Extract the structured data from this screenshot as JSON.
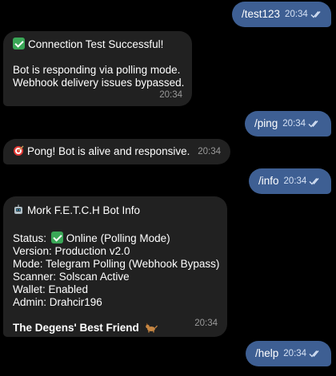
{
  "messages": [
    {
      "id": "m1",
      "direction": "outgoing",
      "text": "/test123",
      "time": "20:34"
    },
    {
      "id": "m2",
      "direction": "incoming",
      "title": "Connection Test Successful!",
      "lines": [
        "Bot is responding via polling mode.",
        "Webhook delivery issues bypassed."
      ],
      "time": "20:34"
    },
    {
      "id": "m3",
      "direction": "outgoing",
      "text": "/ping",
      "time": "20:34"
    },
    {
      "id": "m4",
      "direction": "incoming",
      "text": "Pong! Bot is alive and responsive.",
      "time": "20:34"
    },
    {
      "id": "m5",
      "direction": "outgoing",
      "text": "/info",
      "time": "20:34"
    },
    {
      "id": "m6",
      "direction": "incoming",
      "title": "Mork F.E.T.C.H Bot Info",
      "status_label": "Status:",
      "status_value": "Online (Polling Mode)",
      "lines": [
        "Version: Production v2.0",
        "Mode: Telegram Polling (Webhook Bypass)",
        "Scanner: Solscan Active",
        "Wallet: Enabled",
        "Admin: Drahcir196"
      ],
      "footer": "The Degens' Best Friend",
      "time": "20:34"
    },
    {
      "id": "m7",
      "direction": "outgoing",
      "text": "/help",
      "time": "20:34"
    }
  ],
  "icons": {
    "read_receipt": "double-check-icon",
    "success": "check-mark-emoji-icon",
    "target": "target-emoji-icon",
    "robot": "robot-emoji-icon",
    "dog": "dog-emoji-icon"
  },
  "colors": {
    "background": "#000000",
    "outgoing_bubble": "#3e5f93",
    "incoming_bubble": "#212121"
  }
}
